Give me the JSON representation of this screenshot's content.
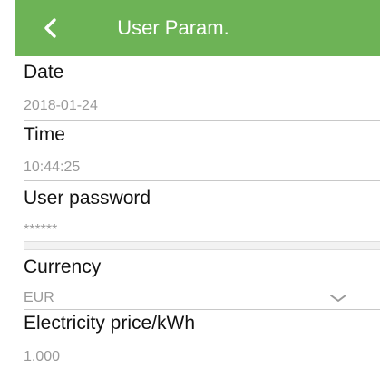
{
  "header": {
    "back_icon": "chevron-left-icon",
    "title": "User Param.",
    "background_color": "#6db356"
  },
  "fields": {
    "date": {
      "label": "Date",
      "value": "2018-01-24"
    },
    "time": {
      "label": "Time",
      "value": "10:44:25"
    },
    "password": {
      "label": "User password",
      "value": "******"
    },
    "currency": {
      "label": "Currency",
      "value": "EUR",
      "dropdown_icon": "chevron-down-icon"
    },
    "price": {
      "label": "Electricity price/kWh",
      "value": "1.000"
    }
  }
}
